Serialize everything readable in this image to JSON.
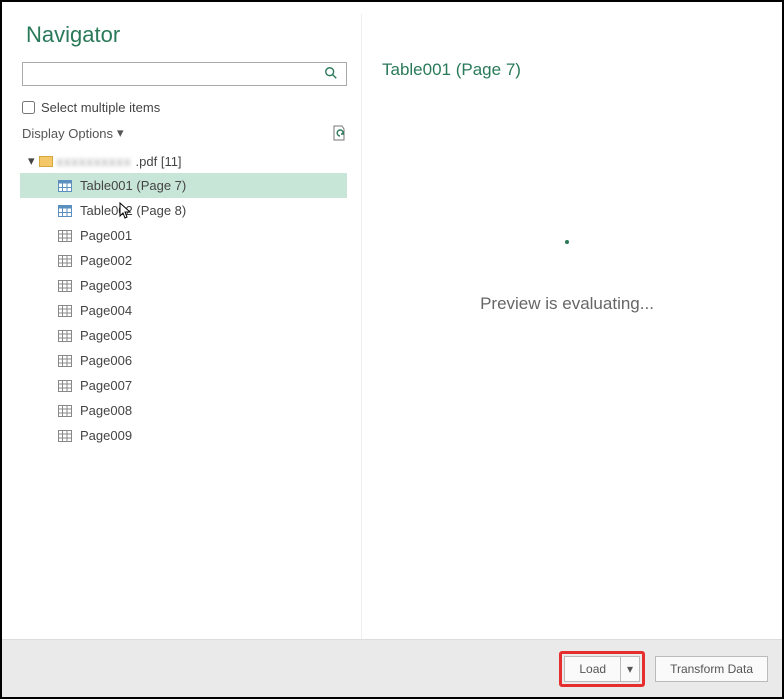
{
  "navigator": {
    "title": "Navigator",
    "search_placeholder": "",
    "select_multiple_label": "Select multiple items",
    "display_options_label": "Display Options",
    "tree": {
      "root_name": ".pdf [11]",
      "items": [
        {
          "label": "Table001 (Page 7)",
          "icon": "table",
          "selected": true
        },
        {
          "label": "Table002 (Page 8)",
          "icon": "table",
          "selected": false
        },
        {
          "label": "Page001",
          "icon": "page",
          "selected": false
        },
        {
          "label": "Page002",
          "icon": "page",
          "selected": false
        },
        {
          "label": "Page003",
          "icon": "page",
          "selected": false
        },
        {
          "label": "Page004",
          "icon": "page",
          "selected": false
        },
        {
          "label": "Page005",
          "icon": "page",
          "selected": false
        },
        {
          "label": "Page006",
          "icon": "page",
          "selected": false
        },
        {
          "label": "Page007",
          "icon": "page",
          "selected": false
        },
        {
          "label": "Page008",
          "icon": "page",
          "selected": false
        },
        {
          "label": "Page009",
          "icon": "page",
          "selected": false
        }
      ]
    }
  },
  "preview": {
    "title": "Table001 (Page 7)",
    "loading_text": "Preview is evaluating..."
  },
  "footer": {
    "load_label": "Load",
    "transform_label": "Transform Data"
  }
}
